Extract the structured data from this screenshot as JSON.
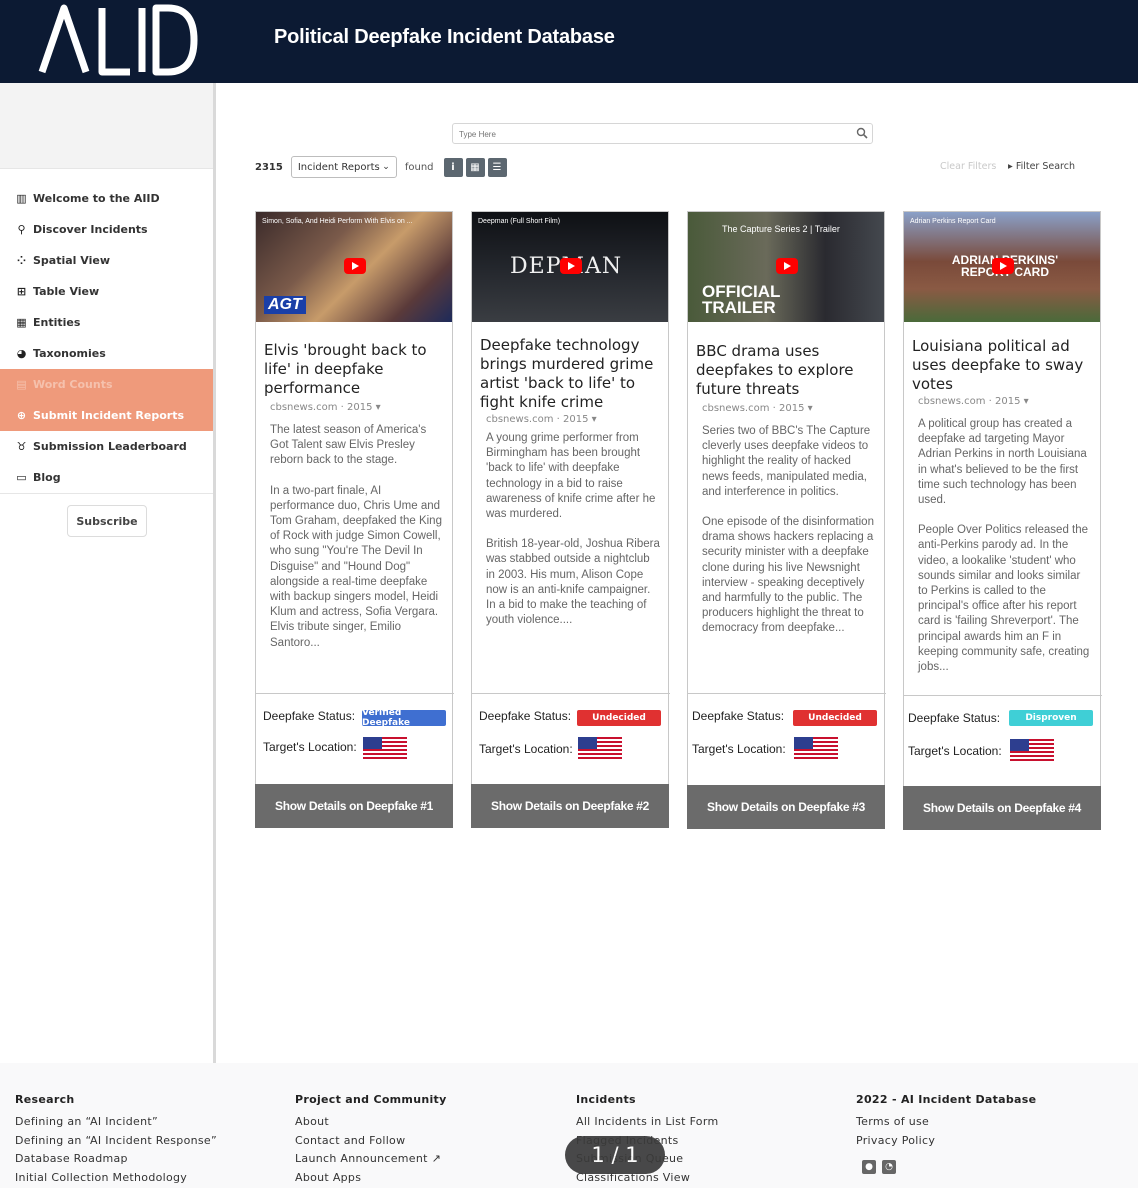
{
  "header": {
    "logo_text": "AIID",
    "title": "Political Deepfake Incident Database"
  },
  "sidebar": {
    "items": [
      {
        "label": "Welcome to the AIID",
        "icon": "book-icon"
      },
      {
        "label": "Discover Incidents",
        "icon": "search-icon"
      },
      {
        "label": "Spatial View",
        "icon": "spatial-icon"
      },
      {
        "label": "Table View",
        "icon": "table-icon"
      },
      {
        "label": "Entities",
        "icon": "building-icon"
      },
      {
        "label": "Taxonomies",
        "icon": "pie-icon"
      },
      {
        "label": "Word Counts",
        "icon": "counts-icon"
      },
      {
        "label": "Submit Incident Reports",
        "icon": "plus-circle-icon"
      },
      {
        "label": "Submission Leaderboard",
        "icon": "trophy-icon"
      },
      {
        "label": "Blog",
        "icon": "newspaper-icon"
      }
    ],
    "subscribe_label": "Subscribe"
  },
  "search": {
    "placeholder": "Type Here"
  },
  "results": {
    "count": "2315",
    "type_selected": "Incident Reports",
    "found_label": "found",
    "clear_filters": "Clear Filters",
    "filter_search": "Filter Search"
  },
  "cards": [
    {
      "thumb_caption": "Simon, Sofia, And Heidi Perform With Elvis on ...",
      "thumb_overlay": "AGT",
      "title": "Elvis 'brought back to life' in deepfake performance",
      "source": "cbsnews.com · 2015",
      "paragraphs": [
        "The latest season of America's Got Talent saw Elvis Presley reborn back to the stage.",
        "In a two-part finale, AI performance duo, Chris Ume and Tom Graham, deepfaked the King of Rock with judge Simon Cowell, who sung \"You're The Devil In Disguise\" and \"Hound Dog\" alongside a real-time deepfake with backup singers model, Heidi Klum and actress, Sofia Vergara. Elvis tribute singer, Emilio Santoro..."
      ],
      "status_label": "Deepfake Status:",
      "status": "Verified Deepfake",
      "status_color": "#3f6fd1",
      "location_label": "Target's Location:",
      "button": "Show Details on Deepfake #1"
    },
    {
      "thumb_caption": "Deepman (Full Short Film)",
      "thumb_overlay": "DEPMAN",
      "title": "Deepfake technology brings murdered grime artist 'back to life' to fight knife crime",
      "source": "cbsnews.com · 2015",
      "paragraphs": [
        "A young grime performer from Birmingham has been brought 'back to life' with deepfake technology in a bid to raise awareness of knife crime after he was murdered.",
        "British 18-year-old, Joshua Ribera was stabbed outside a nightclub in 2003. His mum, Alison Cope now is an anti-knife campaigner. In a bid to make the teaching of youth violence...."
      ],
      "status_label": "Deepfake Status:",
      "status": "Undecided",
      "status_color": "#e03131",
      "location_label": "Target's Location:",
      "button": "Show Details on Deepfake #2"
    },
    {
      "thumb_caption": "The Capture Series 2 | Trailer",
      "thumb_overlay": "OFFICIAL TRAILER",
      "title": "BBC drama uses deepfakes to explore future threats",
      "source": "cbsnews.com · 2015",
      "paragraphs": [
        "Series two of BBC's The Capture cleverly uses deepfake videos to highlight the reality of hacked news feeds, manipulated media, and interference in politics.",
        "One episode of the disinformation drama shows hackers replacing a security minister with a deepfake clone during his live Newsnight interview - speaking deceptively and harmfully to the public. The producers highlight the threat to democracy from deepfake..."
      ],
      "status_label": "Deepfake Status:",
      "status": "Undecided",
      "status_color": "#e03131",
      "location_label": "Target's Location:",
      "button": "Show Details on Deepfake #3"
    },
    {
      "thumb_caption": "Adrian Perkins Report Card",
      "thumb_overlay": "ADRIAN PERKINS' REPORT CARD",
      "title": "Louisiana political ad uses deepfake to sway votes",
      "source": "cbsnews.com · 2015",
      "paragraphs": [
        "A political group has created a deepfake ad targeting Mayor Adrian Perkins in north Louisiana in what's believed to be the first time such technology has been used.",
        "People Over Politics released the anti-Perkins parody ad. In the video, a lookalike 'student' who sounds similar and looks similar to Perkins is called to the principal's office after his report card is 'failing Shreverport'. The principal awards him an F in keeping community safe, creating jobs..."
      ],
      "status_label": "Deepfake Status:",
      "status": "Disproven",
      "status_color": "#3fcfd6",
      "location_label": "Target's Location:",
      "button": "Show Details on Deepfake #4"
    }
  ],
  "footer": {
    "columns": [
      {
        "heading": "Research",
        "links": [
          "Defining an “AI Incident”",
          "Defining an “AI Incident Response”",
          "Database Roadmap",
          "Initial Collection Methodology"
        ]
      },
      {
        "heading": "Project and Community",
        "links": [
          "About",
          "Contact and Follow",
          "Launch Announcement",
          "About Apps"
        ]
      },
      {
        "heading": "Incidents",
        "links": [
          "All Incidents in List Form",
          "Flagged Incidents",
          "Submission Queue",
          "Classifications View"
        ]
      },
      {
        "heading": "2022 - AI Incident Database",
        "links": [
          "Terms of use",
          "Privacy Policy"
        ]
      }
    ],
    "icons": [
      "github-icon",
      "rss-icon"
    ]
  },
  "pager": {
    "text": "1 / 1"
  }
}
